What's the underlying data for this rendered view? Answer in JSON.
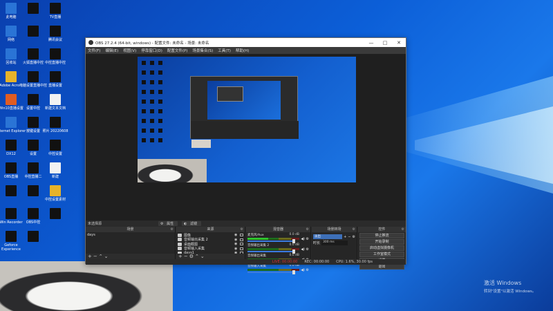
{
  "desktop": {
    "icons": [
      {
        "label": "此电脑",
        "color": "b"
      },
      {
        "label": "",
        "color": ""
      },
      {
        "label": "TV直播",
        "color": ""
      },
      {
        "label": "网络",
        "color": "b"
      },
      {
        "label": "",
        "color": ""
      },
      {
        "label": "腾讯会议",
        "color": ""
      },
      {
        "label": "回收站",
        "color": "b"
      },
      {
        "label": "火狐直播中控",
        "color": ""
      },
      {
        "label": "中控直播中控",
        "color": ""
      },
      {
        "label": "Adobe Acro...",
        "color": "y"
      },
      {
        "label": "电脑设置直播中控",
        "color": ""
      },
      {
        "label": "直播设置",
        "color": ""
      },
      {
        "label": "Win10直播设置",
        "color": "c"
      },
      {
        "label": "设置中控",
        "color": ""
      },
      {
        "label": "新建文本文档",
        "color": "w"
      },
      {
        "label": "Internet Explorer",
        "color": "b"
      },
      {
        "label": "按键设置",
        "color": ""
      },
      {
        "label": "照片 20220608",
        "color": ""
      },
      {
        "label": "DX12",
        "color": ""
      },
      {
        "label": "设置",
        "color": ""
      },
      {
        "label": "中控设置",
        "color": ""
      },
      {
        "label": "OBS直播",
        "color": ""
      },
      {
        "label": "中控直播二",
        "color": ""
      },
      {
        "label": "新建",
        "color": "w"
      },
      {
        "label": "",
        "color": ""
      },
      {
        "label": "",
        "color": ""
      },
      {
        "label": "中控设置素材",
        "color": "y"
      },
      {
        "label": "Win Recorder",
        "color": ""
      },
      {
        "label": "OBS中控",
        "color": ""
      },
      {
        "label": "",
        "color": ""
      },
      {
        "label": "Geforce Experience",
        "color": ""
      },
      {
        "label": "",
        "color": ""
      }
    ],
    "activation_title": "激活 Windows",
    "activation_sub": "转到\"设置\"以激活 Windows。"
  },
  "obs": {
    "title": "OBS 27.2.4 (64-bit, windows) - 配置文件: 未命名 - 场景: 未命名",
    "win_buttons": [
      "—",
      "□",
      "✕"
    ],
    "menu": [
      "文件(F)",
      "编辑(E)",
      "视图(V)",
      "停靠窗口(D)",
      "配置文件(P)",
      "场景集合(S)",
      "工具(T)",
      "帮助(H)"
    ],
    "scene_bar_label": "未选择源",
    "scene_bar_props": "属性",
    "scene_bar_filters": "滤镜",
    "docks": {
      "scenes": {
        "title": "场景",
        "items": [
          "days"
        ]
      },
      "sources": {
        "title": "来源",
        "items": [
          "图像",
          "音频输出采集 2",
          "桌面截图",
          "音频输入采集",
          "days1",
          "@队友打电话"
        ]
      },
      "mixer": {
        "title": "混音器",
        "channels": [
          {
            "name": "麦克风/Aux",
            "db": "0.0 dB"
          },
          {
            "name": "音频输出采集 2",
            "db": "0.0 dB"
          },
          {
            "name": "音频输出采集",
            "db": "0.0 dB"
          },
          {
            "name": "音频输入采集",
            "db": "0.0 dB"
          }
        ]
      },
      "transitions": {
        "title": "场景转场",
        "type": "淡出",
        "duration_label": "时长",
        "duration": "300 ms"
      },
      "controls": {
        "title": "控件",
        "buttons": [
          "停止推流",
          "开始录制",
          "启动虚拟摄像机",
          "工作室模式",
          "设置",
          "退出"
        ]
      }
    },
    "status": {
      "live": "LIVE: 00:00:00",
      "rec": "REC: 00:00:00",
      "cpu": "CPU: 1.6%, 30.00 fps"
    }
  }
}
